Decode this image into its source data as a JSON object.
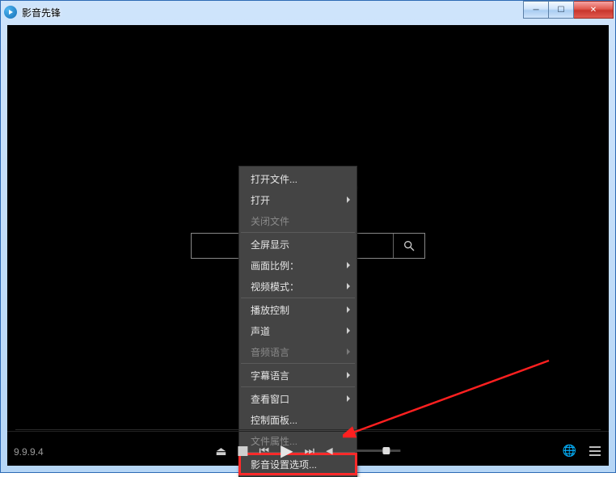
{
  "window": {
    "title": "影音先锋"
  },
  "footer": {
    "version": "9.9.9.4"
  },
  "search": {
    "placeholder": ""
  },
  "context_menu": {
    "items": [
      {
        "label": "打开文件...",
        "disabled": false,
        "submenu": false
      },
      {
        "label": "打开",
        "disabled": false,
        "submenu": true
      },
      {
        "label": "关闭文件",
        "disabled": true,
        "submenu": false
      },
      "sep",
      {
        "label": "全屏显示",
        "disabled": false,
        "submenu": false
      },
      {
        "label": "画面比例：",
        "disabled": false,
        "submenu": true
      },
      {
        "label": "视频模式：",
        "disabled": false,
        "submenu": true
      },
      "sep",
      {
        "label": "播放控制",
        "disabled": false,
        "submenu": true
      },
      {
        "label": "声道",
        "disabled": false,
        "submenu": true
      },
      {
        "label": "音频语言",
        "disabled": true,
        "submenu": true
      },
      "sep",
      {
        "label": "字幕语言",
        "disabled": false,
        "submenu": true
      },
      "sep",
      {
        "label": "查看窗口",
        "disabled": false,
        "submenu": true
      },
      {
        "label": "控制面板...",
        "disabled": false,
        "submenu": false
      },
      {
        "label": "文件属性...",
        "disabled": true,
        "submenu": false
      },
      "sep",
      {
        "label": "影音设置选项...",
        "disabled": false,
        "submenu": false,
        "highlight": true
      }
    ]
  }
}
